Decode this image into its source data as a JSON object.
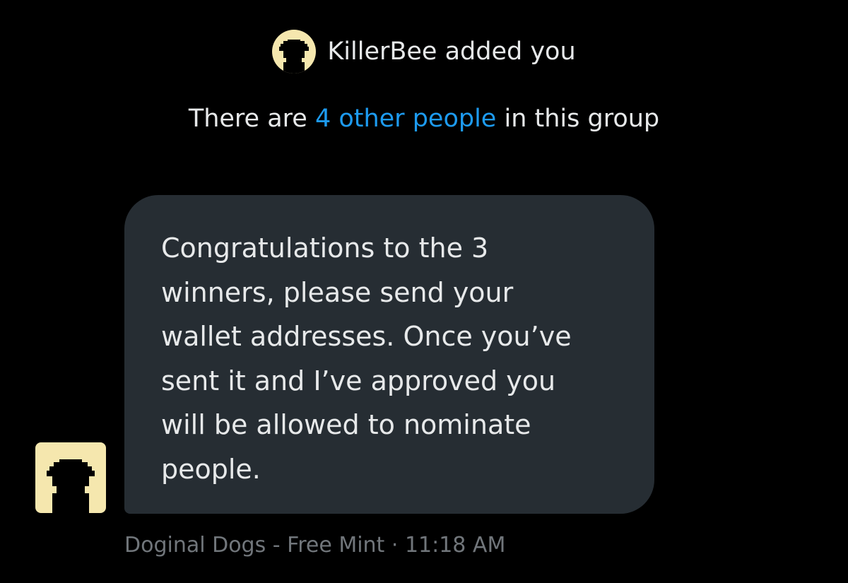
{
  "system_notice": {
    "text": "KillerBee added you",
    "avatar_icon": "dog-silhouette-icon"
  },
  "group_info": {
    "before": "There are ",
    "link": "4 other people",
    "after": " in this group"
  },
  "message": {
    "text": "Congratulations to the 3\nwinners, please send your\nwallet addresses. Once you’ve\nsent it and I’ve approved you\nwill be allowed to nominate\npeople.",
    "avatar_icon": "dog-silhouette-icon"
  },
  "meta": {
    "sender": "Doginal Dogs - Free Mint",
    "separator": " · ",
    "time": "11:18 AM"
  },
  "colors": {
    "background": "#000000",
    "bubble": "#262d33",
    "text": "#e7e9ea",
    "muted": "#71767b",
    "link": "#1d9bf0",
    "avatar_bg": "#f5e7ae"
  }
}
